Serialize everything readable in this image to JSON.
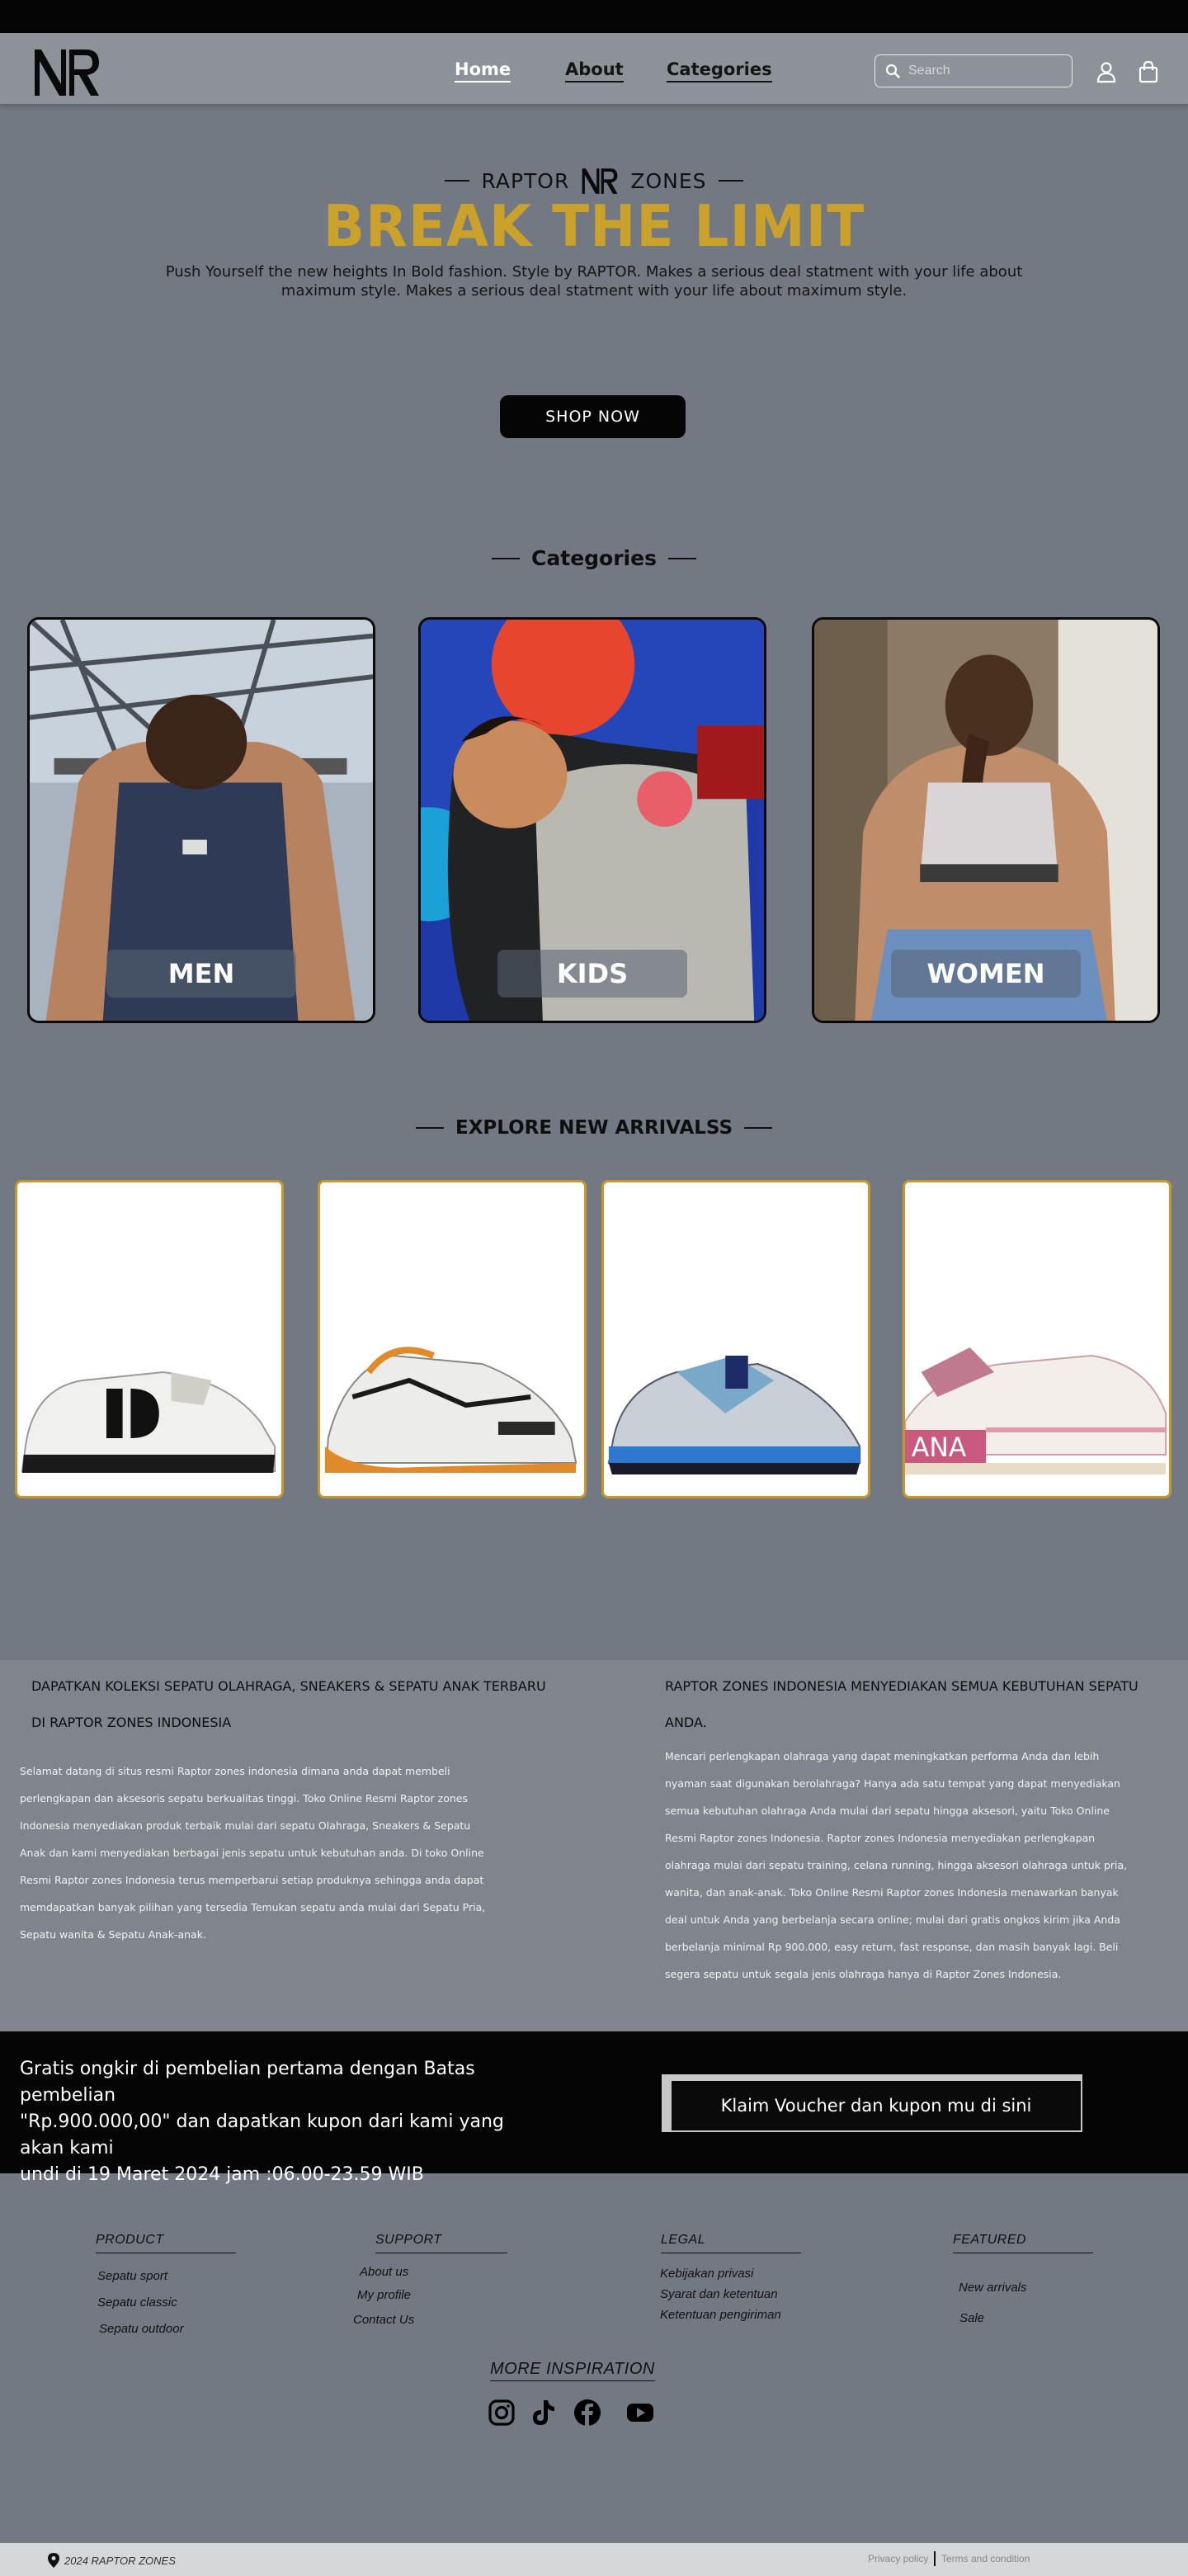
{
  "nav": {
    "links": [
      "Home",
      "About",
      "Categories"
    ],
    "search_placeholder": "Search",
    "icons": [
      "raptor-logo",
      "search-icon",
      "user-icon",
      "shopping-bag-icon"
    ]
  },
  "hero": {
    "brand_left": "RAPTOR",
    "brand_right": "ZONES",
    "title": "BREAK THE LIMIT",
    "subtitle": "Push Yourself the new heights In Bold fashion. Style by RAPTOR. Makes a serious deal statment with your life about maximum style. Makes a serious deal statment with your life about maximum style.",
    "cta": "SHOP NOW",
    "title_color": "#c9a12b"
  },
  "categories": {
    "title": "Categories",
    "items": [
      "MEN",
      "KIDS",
      "WOMEN"
    ]
  },
  "arrivals": {
    "title": "EXPLORE NEW ARRIVALSS",
    "card_border_color": "#c8972c"
  },
  "info": {
    "left_title_1": "DAPATKAN KOLEKSI SEPATU OLAHRAGA, SNEAKERS & SEPATU ANAK TERBARU",
    "left_title_2": "DI RAPTOR ZONES INDONESIA",
    "left_lines": [
      "Selamat datang di situs resmi Raptor zones indonesia dimana anda dapat membeli",
      "perlengkapan dan aksesoris sepatu berkualitas tinggi. Toko Online Resmi Raptor zones",
      "Indonesia menyediakan  produk terbaik mulai dari sepatu Olahraga, Sneakers & Sepatu",
      "Anak dan kami menyediakan  berbagai jenis sepatu untuk kebutuhan anda. Di toko Online",
      "Resmi Raptor zones Indonesia terus  memperbarui setiap produknya sehingga anda dapat",
      "memdapatkan banyak pilihan yang tersedia Temukan sepatu anda mulai dari Sepatu Pria,",
      "Sepatu wanita & Sepatu Anak-anak."
    ],
    "right_title_1": "RAPTOR ZONES INDONESIA MENYEDIAKAN SEMUA KEBUTUHAN SEPATU",
    "right_title_2": "ANDA.",
    "right_lines": [
      "Mencari perlengkapan olahraga yang dapat meningkatkan performa Anda dan lebih",
      "nyaman saat digunakan berolahraga? Hanya ada satu tempat yang dapat menyediakan",
      "semua kebutuhan olahraga Anda mulai dari sepatu hingga aksesori, yaitu Toko Online",
      "Resmi Raptor zones Indonesia. Raptor zones Indonesia menyediakan perlengkapan",
      "olahraga mulai dari sepatu training, celana running, hingga aksesori olahraga untuk pria,",
      "wanita, dan anak-anak. Toko Online Resmi Raptor zones Indonesia menawarkan banyak",
      "deal untuk Anda yang berbelanja secara online; mulai dari gratis ongkos kirim jika Anda",
      "berbelanja minimal Rp 900.000, easy return, fast response, dan masih banyak lagi. Beli",
      "segera sepatu untuk segala jenis olahraga hanya di Raptor Zones Indonesia."
    ]
  },
  "promo": {
    "lines": [
      "Gratis ongkir di pembelian pertama dengan Batas pembelian",
      "\"Rp.900.000,00\" dan dapatkan kupon dari kami yang akan kami",
      "undi di 19 Maret 2024 jam :06.00-23.59 WIB"
    ],
    "button": "Klaim Voucher dan kupon mu di sini"
  },
  "footer": {
    "columns": [
      {
        "title": "PRODUCT",
        "links": [
          "Sepatu sport",
          "Sepatu classic",
          "Sepatu outdoor"
        ]
      },
      {
        "title": "SUPPORT",
        "links": [
          "About us",
          "My profile",
          "Contact Us"
        ]
      },
      {
        "title": "LEGAL",
        "links": [
          "Kebijakan privasi",
          "Syarat dan ketentuan",
          "Ketentuan pengiriman"
        ]
      },
      {
        "title": "FEATURED",
        "links": [
          "New arrivals",
          "Sale"
        ]
      }
    ],
    "more_inspiration": "MORE INSPIRATION",
    "social_icons": [
      "instagram-icon",
      "tiktok-icon",
      "facebook-icon",
      "youtube-icon"
    ],
    "copyright": "2024 RAPTOR ZONES",
    "legal_links": [
      "Privacy policy",
      "Terms and condition"
    ]
  }
}
